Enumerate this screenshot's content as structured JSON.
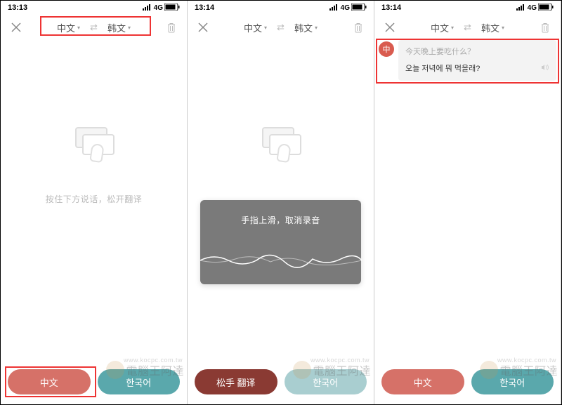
{
  "screens": [
    {
      "status": {
        "time": "13:13",
        "network": "4G"
      },
      "toolbar": {
        "src_lang": "中文",
        "dst_lang": "韩文"
      },
      "hint": "按住下方说话，松开翻译",
      "buttons": {
        "left": "中文",
        "right": "한국어"
      },
      "highlights": {
        "langbar": true,
        "left_btn": true
      }
    },
    {
      "status": {
        "time": "13:14",
        "network": "4G"
      },
      "toolbar": {
        "src_lang": "中文",
        "dst_lang": "韩文"
      },
      "recording_hint": "手指上滑，取消录音",
      "buttons": {
        "left": "松手 翻译",
        "right": "한국어"
      }
    },
    {
      "status": {
        "time": "13:14",
        "network": "4G"
      },
      "toolbar": {
        "src_lang": "中文",
        "dst_lang": "韩文"
      },
      "result": {
        "badge": "中",
        "source": "今天晚上要吃什么？",
        "translation": "오늘 저녁에 뭐 먹을래?"
      },
      "buttons": {
        "left": "中文",
        "right": "한국어"
      },
      "highlights": {
        "result": true
      }
    }
  ],
  "watermark": {
    "text": "電腦王阿達",
    "sub": "www.kocpc.com.tw"
  }
}
